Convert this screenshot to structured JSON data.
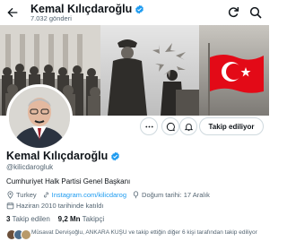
{
  "header": {
    "name": "Kemal Kılıçdaroğlu",
    "post_count": "7.032 gönderi"
  },
  "profile": {
    "name": "Kemal Kılıçdaroğlu",
    "handle": "@kilicdarogluk",
    "bio": "Cumhuriyet Halk Partisi Genel Başkanı",
    "location": "Turkey",
    "website": "Instagram.com/kilicdarog",
    "birthday": "Doğum tarihi: 17 Aralık",
    "joined": "Haziran 2010 tarihinde katıldı"
  },
  "actions": {
    "follow_label": "Takip ediliyor"
  },
  "stats": {
    "following_count": "3",
    "following_label": "Takip edilen",
    "followers_count": "9,2 Mn",
    "followers_label": "Takipçi"
  },
  "followed_by": "Müsavat Dervişoğlu, ANKARA KUŞU ve takip ettiğin diğer 6 kişi tarafından takip ediliyor",
  "colors": {
    "accent": "#1d9bf0",
    "text": "#0f1419",
    "secondary_text": "#536471",
    "border": "#cfd9de",
    "flag_red": "#e30a17"
  },
  "icons": [
    "back-arrow-icon",
    "verified-badge-icon",
    "refresh-icon",
    "search-icon",
    "more-options-icon",
    "message-icon",
    "notification-bell-icon",
    "location-icon",
    "link-icon",
    "balloon-icon",
    "calendar-icon"
  ]
}
